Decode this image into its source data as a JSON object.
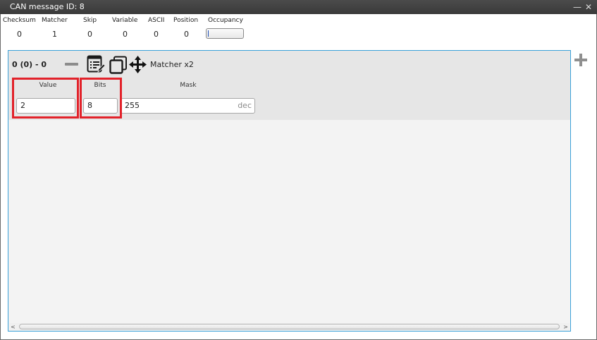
{
  "window": {
    "title": "CAN message ID: 8",
    "minimize_glyph": "—",
    "close_glyph": "✕"
  },
  "stats": {
    "columns": [
      {
        "label": "Checksum",
        "value": "0"
      },
      {
        "label": "Matcher",
        "value": "1"
      },
      {
        "label": "Skip",
        "value": "0"
      },
      {
        "label": "Variable",
        "value": "0"
      },
      {
        "label": "ASCII",
        "value": "0"
      },
      {
        "label": "Position",
        "value": "0"
      },
      {
        "label": "Occupancy",
        "value": ""
      }
    ],
    "occupancy_fraction": 0.0
  },
  "matcher": {
    "row_id": "0 (0) - 0",
    "type_label": "Matcher x2",
    "fields": {
      "value_label": "Value",
      "value": "2",
      "bits_label": "Bits",
      "bits": "8",
      "mask_label": "Mask",
      "mask": "255",
      "mask_unit": "dec"
    },
    "icons": [
      "minus-icon",
      "list-edit-icon",
      "copy-icon",
      "move-icon"
    ]
  },
  "toolbar": {
    "add_icon": "plus-icon"
  },
  "scrollbar": {
    "left_arrow": "<",
    "right_arrow": ">"
  },
  "colors": {
    "title_bar": "#3f3f3f",
    "panel_border": "#3aa0d8",
    "highlight": "#e2222a",
    "occupancy_cursor": "#1f4fb5"
  }
}
